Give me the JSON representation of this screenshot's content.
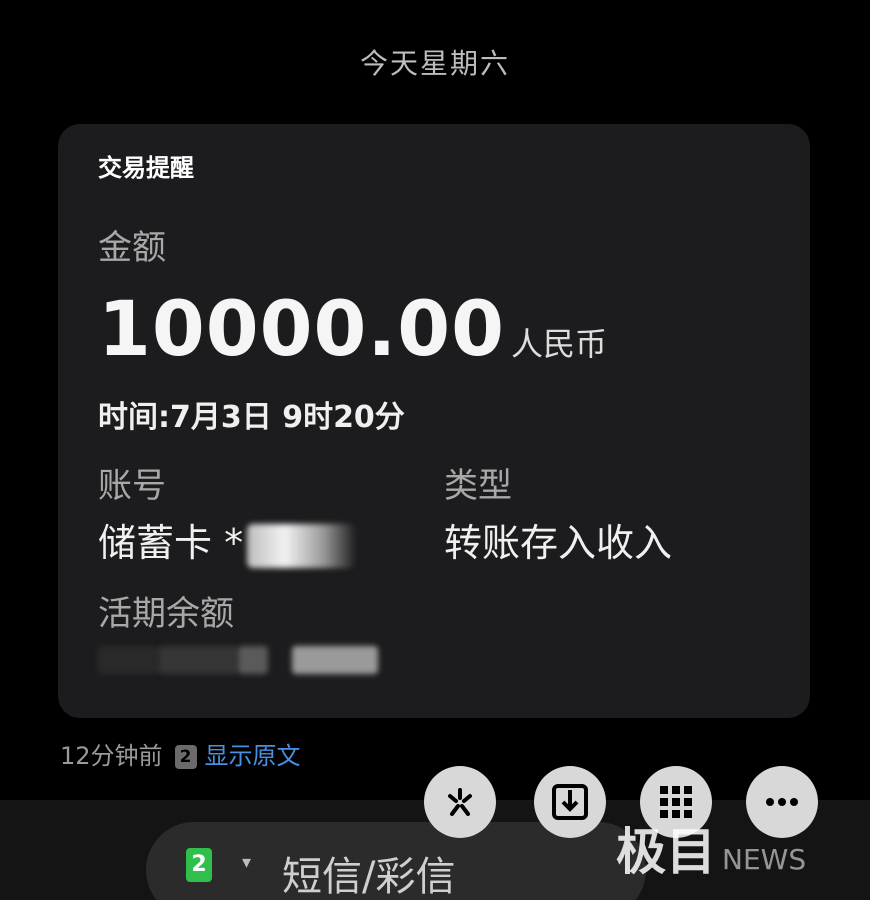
{
  "date_header": "今天星期六",
  "card": {
    "title": "交易提醒",
    "amount_label": "金额",
    "amount_value": "10000.00",
    "amount_currency": "人民币",
    "time_line": "时间:7月3日 9时20分",
    "account_label": "账号",
    "account_value": "储蓄卡 *",
    "type_label": "类型",
    "type_value": "转账存入收入",
    "balance_label": "活期余额"
  },
  "meta": {
    "time_ago": "12分钟前",
    "sim_slot": "2",
    "show_original": "显示原文"
  },
  "composer": {
    "sim_slot": "2",
    "placeholder": "短信/彩信"
  },
  "watermark": {
    "brand": "极目",
    "sub": "NEWS"
  },
  "icons": {
    "quick_action": "sparkle-icon",
    "download": "download-icon",
    "apps": "grid-icon",
    "more": "more-icon"
  },
  "colors": {
    "background": "#000000",
    "card": "#1c1c1e",
    "link": "#4a90e2",
    "sim_green": "#2fbf4a"
  }
}
